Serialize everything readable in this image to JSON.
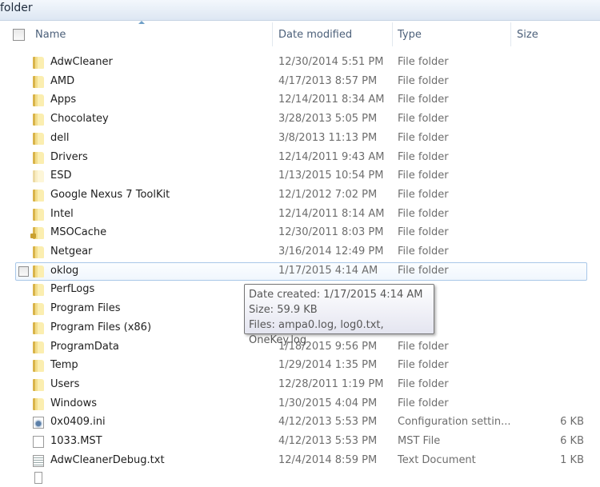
{
  "window": {
    "title": "folder"
  },
  "columns": {
    "name": "Name",
    "date": "Date modified",
    "type": "Type",
    "size": "Size"
  },
  "rows": [
    {
      "name": "AdwCleaner",
      "date": "12/30/2014 5:51 PM",
      "type": "File folder",
      "size": "",
      "icon": "folder"
    },
    {
      "name": "AMD",
      "date": "4/17/2013 8:57 PM",
      "type": "File folder",
      "size": "",
      "icon": "folder"
    },
    {
      "name": "Apps",
      "date": "12/14/2011 8:34 AM",
      "type": "File folder",
      "size": "",
      "icon": "folder"
    },
    {
      "name": "Chocolatey",
      "date": "3/28/2013 5:05 PM",
      "type": "File folder",
      "size": "",
      "icon": "folder"
    },
    {
      "name": "dell",
      "date": "3/8/2013 11:13 PM",
      "type": "File folder",
      "size": "",
      "icon": "folder"
    },
    {
      "name": "Drivers",
      "date": "12/14/2011 9:43 AM",
      "type": "File folder",
      "size": "",
      "icon": "folder"
    },
    {
      "name": "ESD",
      "date": "1/13/2015 10:54 PM",
      "type": "File folder",
      "size": "",
      "icon": "folder-hidden"
    },
    {
      "name": "Google Nexus 7 ToolKit",
      "date": "12/1/2012 7:02 PM",
      "type": "File folder",
      "size": "",
      "icon": "folder"
    },
    {
      "name": "Intel",
      "date": "12/14/2011 8:14 AM",
      "type": "File folder",
      "size": "",
      "icon": "folder"
    },
    {
      "name": "MSOCache",
      "date": "12/30/2011 8:03 PM",
      "type": "File folder",
      "size": "",
      "icon": "folder-locked"
    },
    {
      "name": "Netgear",
      "date": "3/16/2014 12:49 PM",
      "type": "File folder",
      "size": "",
      "icon": "folder"
    },
    {
      "name": "oklog",
      "date": "1/17/2015 4:14 AM",
      "type": "File folder",
      "size": "",
      "icon": "folder",
      "hover": true
    },
    {
      "name": "PerfLogs",
      "date": "",
      "type": "",
      "size": "",
      "icon": "folder"
    },
    {
      "name": "Program Files",
      "date": "",
      "type": "",
      "size": "",
      "icon": "folder"
    },
    {
      "name": "Program Files (x86)",
      "date": "",
      "type": "",
      "size": "",
      "icon": "folder"
    },
    {
      "name": "ProgramData",
      "date": "1/18/2015 9:56 PM",
      "type": "File folder",
      "size": "",
      "icon": "folder"
    },
    {
      "name": "Temp",
      "date": "1/29/2014 1:35 PM",
      "type": "File folder",
      "size": "",
      "icon": "folder"
    },
    {
      "name": "Users",
      "date": "12/28/2011 1:19 PM",
      "type": "File folder",
      "size": "",
      "icon": "folder"
    },
    {
      "name": "Windows",
      "date": "1/30/2015 4:04 PM",
      "type": "File folder",
      "size": "",
      "icon": "folder"
    },
    {
      "name": "0x0409.ini",
      "date": "4/12/2013 5:53 PM",
      "type": "Configuration settin...",
      "size": "6 KB",
      "icon": "config"
    },
    {
      "name": "1033.MST",
      "date": "4/12/2013 5:53 PM",
      "type": "MST File",
      "size": "6 KB",
      "icon": "file"
    },
    {
      "name": "AdwCleanerDebug.txt",
      "date": "12/4/2014 8:59 PM",
      "type": "Text Document",
      "size": "1 KB",
      "icon": "text"
    }
  ],
  "tooltip": {
    "line1": "Date created: 1/17/2015 4:14 AM",
    "line2": "Size: 59.9 KB",
    "line3": "Files: ampa0.log, log0.txt, OneKey.log"
  }
}
